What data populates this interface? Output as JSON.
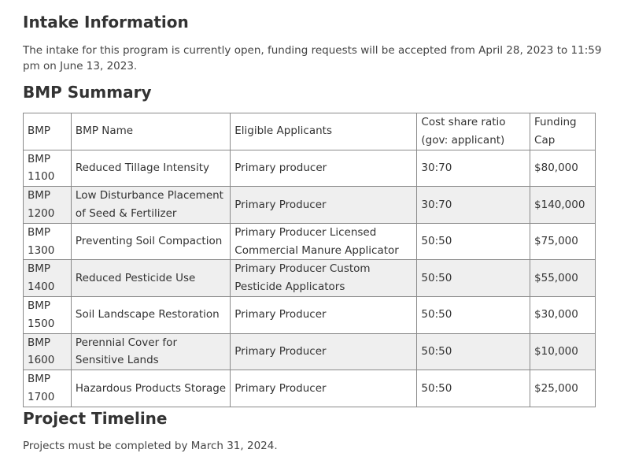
{
  "intake": {
    "heading": "Intake Information",
    "text": "The intake for this program is currently open, funding requests will be accepted from April 28, 2023 to 11:59 pm on June 13, 2023."
  },
  "bmp_summary": {
    "heading": "BMP Summary",
    "headers": [
      "BMP",
      "BMP Name",
      "Eligible Applicants",
      "Cost share ratio (gov: applicant)",
      "Funding Cap"
    ],
    "rows": [
      {
        "bmp": "BMP 1100",
        "name": "Reduced Tillage Intensity",
        "applicants": "Primary producer",
        "ratio": "30:70",
        "cap": "$80,000"
      },
      {
        "bmp": "BMP 1200",
        "name": "Low Disturbance Placement of Seed & Fertilizer",
        "applicants": "Primary Producer",
        "ratio": "30:70",
        "cap": "$140,000"
      },
      {
        "bmp": "BMP 1300",
        "name": "Preventing Soil Compaction",
        "applicants": "Primary Producer Licensed Commercial Manure Applicator",
        "ratio": "50:50",
        "cap": "$75,000"
      },
      {
        "bmp": "BMP 1400",
        "name": "Reduced Pesticide Use",
        "applicants": "Primary Producer Custom Pesticide Applicators",
        "ratio": "50:50",
        "cap": "$55,000"
      },
      {
        "bmp": "BMP 1500",
        "name": "Soil Landscape Restoration",
        "applicants": "Primary Producer",
        "ratio": "50:50",
        "cap": "$30,000"
      },
      {
        "bmp": "BMP 1600",
        "name": "Perennial Cover for Sensitive Lands",
        "applicants": "Primary Producer",
        "ratio": "50:50",
        "cap": "$10,000"
      },
      {
        "bmp": "BMP 1700",
        "name": "Hazardous Products Storage",
        "applicants": "Primary Producer",
        "ratio": "50:50",
        "cap": "$25,000"
      }
    ]
  },
  "timeline": {
    "heading": "Project Timeline",
    "text": "Projects must be completed by March 31, 2024."
  }
}
